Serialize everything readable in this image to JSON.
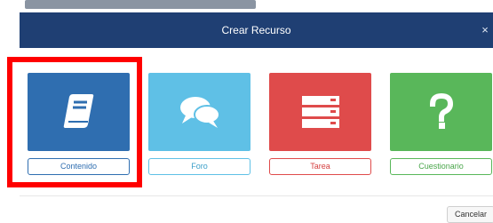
{
  "modal": {
    "title": "Crear Recurso",
    "close_glyph": "×"
  },
  "resources": [
    {
      "label": "Contenido",
      "icon": "book-icon",
      "color": "#2f6eb0"
    },
    {
      "label": "Foro",
      "icon": "speech-bubbles-icon",
      "color": "#5fc0e6"
    },
    {
      "label": "Tarea",
      "icon": "task-list-icon",
      "color": "#df4b4b"
    },
    {
      "label": "Cuestionario",
      "icon": "question-mark-icon",
      "color": "#59b75a"
    }
  ],
  "footer": {
    "cancel_label": "Cancelar"
  },
  "annotation": {
    "highlight_color": "#ff0000"
  }
}
